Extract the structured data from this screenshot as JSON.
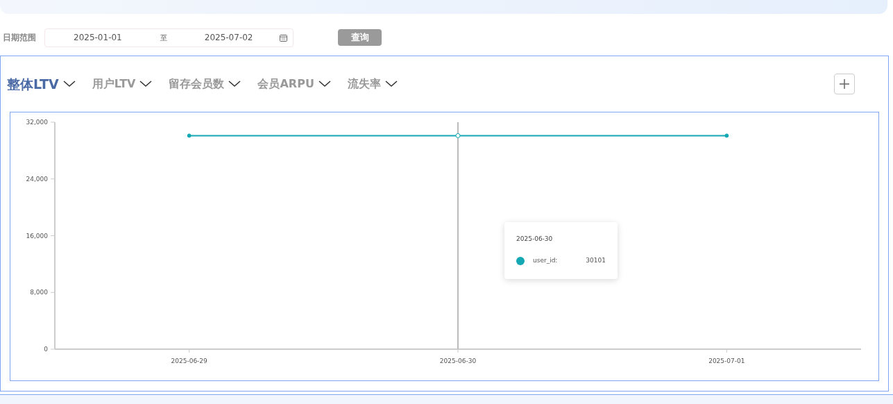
{
  "filter": {
    "label": "日期范围",
    "start_date": "2025-01-01",
    "separator": "至",
    "end_date": "2025-07-02",
    "query_button": "查询"
  },
  "tabs": [
    {
      "label": "整体LTV",
      "selected": true
    },
    {
      "label": "用户LTV",
      "selected": false
    },
    {
      "label": "留存会员数",
      "selected": false
    },
    {
      "label": "会员ARPU",
      "selected": false
    },
    {
      "label": "流失率",
      "selected": false
    }
  ],
  "chart": {
    "chart_data": {
      "type": "line",
      "categories": [
        "2025-06-29",
        "2025-06-30",
        "2025-07-01"
      ],
      "series": [
        {
          "name": "user_id",
          "color": "#13a8b4",
          "marker": "circle",
          "values": [
            30101,
            30101,
            30101
          ]
        }
      ],
      "ylim": [
        0,
        32000
      ],
      "yticks": [
        {
          "value": 0,
          "label": "0"
        },
        {
          "value": 8000,
          "label": "8,000"
        },
        {
          "value": 16000,
          "label": "16,000"
        },
        {
          "value": 24000,
          "label": "24,000"
        },
        {
          "value": 32000,
          "label": "32,000"
        }
      ]
    },
    "points": [
      {
        "selected": false
      },
      {
        "selected": true
      },
      {
        "selected": false
      }
    ],
    "tooltip": {
      "title": "2025-06-30",
      "separator": ":",
      "value": "30101"
    }
  }
}
